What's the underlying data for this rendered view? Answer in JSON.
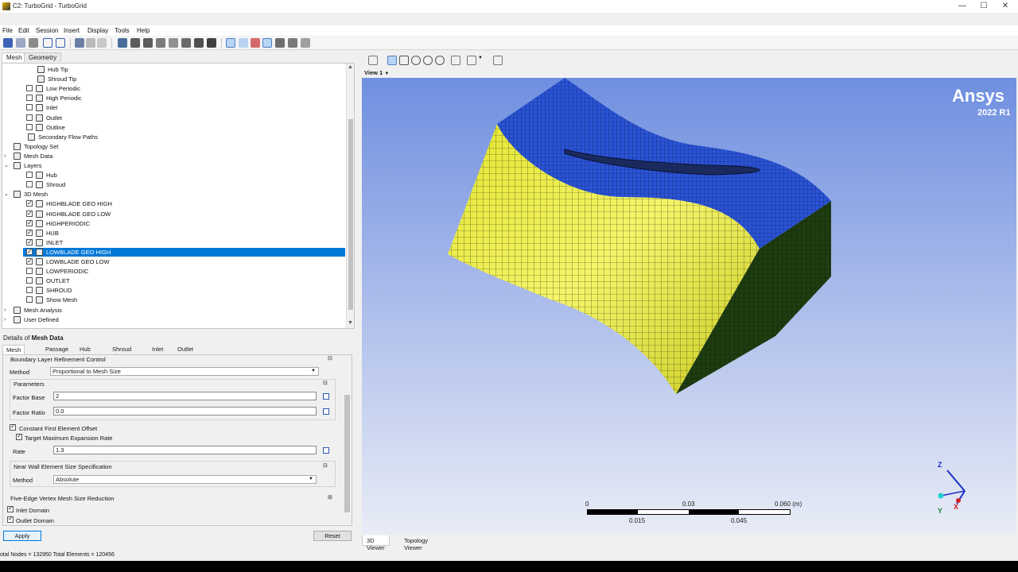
{
  "window": {
    "title": "C2: TurboGrid - TurboGrid",
    "minimize": "—",
    "maximize": "☐",
    "close": "✕"
  },
  "menu": [
    "File",
    "Edit",
    "Session",
    "Insert",
    "Display",
    "Tools",
    "Help"
  ],
  "left_tabs": [
    "Mesh",
    "Geometry"
  ],
  "tree": {
    "items": [
      {
        "label": "Hub Tip",
        "checkbox": null,
        "indent": 3
      },
      {
        "label": "Shroud Tip",
        "checkbox": null,
        "indent": 3
      },
      {
        "label": "Low Periodic",
        "checkbox": false,
        "indent": 2
      },
      {
        "label": "High Periodic",
        "checkbox": false,
        "indent": 2
      },
      {
        "label": "Inlet",
        "checkbox": false,
        "indent": 2
      },
      {
        "label": "Outlet",
        "checkbox": false,
        "indent": 2
      },
      {
        "label": "Outline",
        "checkbox": false,
        "indent": 2
      },
      {
        "label": "Secondary Flow Paths",
        "checkbox": null,
        "indent": 2
      },
      {
        "label": "Topology Set",
        "checkbox": null,
        "indent": 1
      },
      {
        "label": "Mesh Data",
        "checkbox": null,
        "indent": 1,
        "expander": "›"
      },
      {
        "label": "Layers",
        "checkbox": null,
        "indent": 1,
        "expander": "⌄"
      },
      {
        "label": "Hub",
        "checkbox": false,
        "indent": 2
      },
      {
        "label": "Shroud",
        "checkbox": false,
        "indent": 2
      },
      {
        "label": "3D Mesh",
        "checkbox": null,
        "indent": 1,
        "expander": "⌄"
      },
      {
        "label": "HIGHBLADE GEO HIGH",
        "checkbox": true,
        "indent": 2
      },
      {
        "label": "HIGHBLADE GEO LOW",
        "checkbox": true,
        "indent": 2
      },
      {
        "label": "HIGHPERIODIC",
        "checkbox": true,
        "indent": 2
      },
      {
        "label": "HUB",
        "checkbox": true,
        "indent": 2
      },
      {
        "label": "INLET",
        "checkbox": true,
        "indent": 2
      },
      {
        "label": "LOWBLADE GEO HIGH",
        "checkbox": true,
        "indent": 2,
        "selected": true
      },
      {
        "label": "LOWBLADE GEO LOW",
        "checkbox": true,
        "indent": 2
      },
      {
        "label": "LOWPERIODIC",
        "checkbox": false,
        "indent": 2
      },
      {
        "label": "OUTLET",
        "checkbox": false,
        "indent": 2
      },
      {
        "label": "SHROUD",
        "checkbox": false,
        "indent": 2
      },
      {
        "label": "Show Mesh",
        "checkbox": false,
        "indent": 2
      },
      {
        "label": "Mesh Analysis",
        "checkbox": null,
        "indent": 1,
        "expander": "›"
      },
      {
        "label": "User Defined",
        "checkbox": null,
        "indent": 1,
        "expander": "›"
      }
    ]
  },
  "details": {
    "title_prefix": "Details of ",
    "title_bold": "Mesh Data",
    "tabs": [
      "Mesh Size",
      "Passage",
      "Hub Tip",
      "Shroud Tip",
      "Inlet",
      "Outlet"
    ],
    "blrc_label": "Boundary Layer Refinement Control",
    "method_label": "Method",
    "method_value": "Proportional to Mesh Size",
    "parameters_label": "Parameters",
    "factor_base_label": "Factor Base",
    "factor_base_value": "2",
    "factor_ratio_label": "Factor Ratio",
    "factor_ratio_value": "0.0",
    "cfeo_label": "Constant First Element Offset",
    "cfeo_checked": true,
    "tmer_label": "Target Maximum Expansion Rate",
    "tmer_checked": true,
    "rate_label": "Rate",
    "rate_value": "1.3",
    "nwess_label": "Near Wall Element Size Specification",
    "nw_method_label": "Method",
    "nw_method_value": "Absolute",
    "five_edge_label": "Five-Edge Vertex Mesh Size Reduction",
    "inlet_domain_label": "Inlet Domain",
    "inlet_domain_checked": true,
    "outlet_domain_label": "Outlet Domain",
    "outlet_domain_checked": true,
    "apply": "Apply",
    "reset": "Reset"
  },
  "status": "otal Nodes = 132950  Total Elements = 120456",
  "viewer": {
    "view_label": "View 1",
    "logo": "Ansys",
    "version": "2022 R1",
    "scale_top": [
      "0",
      "0.03",
      "0.060  (m)"
    ],
    "scale_bottom": [
      "0.015",
      "0.045"
    ],
    "axis_z": "Z",
    "axis_y": "Y",
    "axis_x": "X",
    "bottom_tabs": [
      "3D Viewer",
      "Topology Viewer"
    ]
  },
  "colors": {
    "selection": "#0078d7",
    "hub_face": "#2b54d6",
    "side_face": "#e8e83a",
    "dark_face": "#1f3d10"
  }
}
